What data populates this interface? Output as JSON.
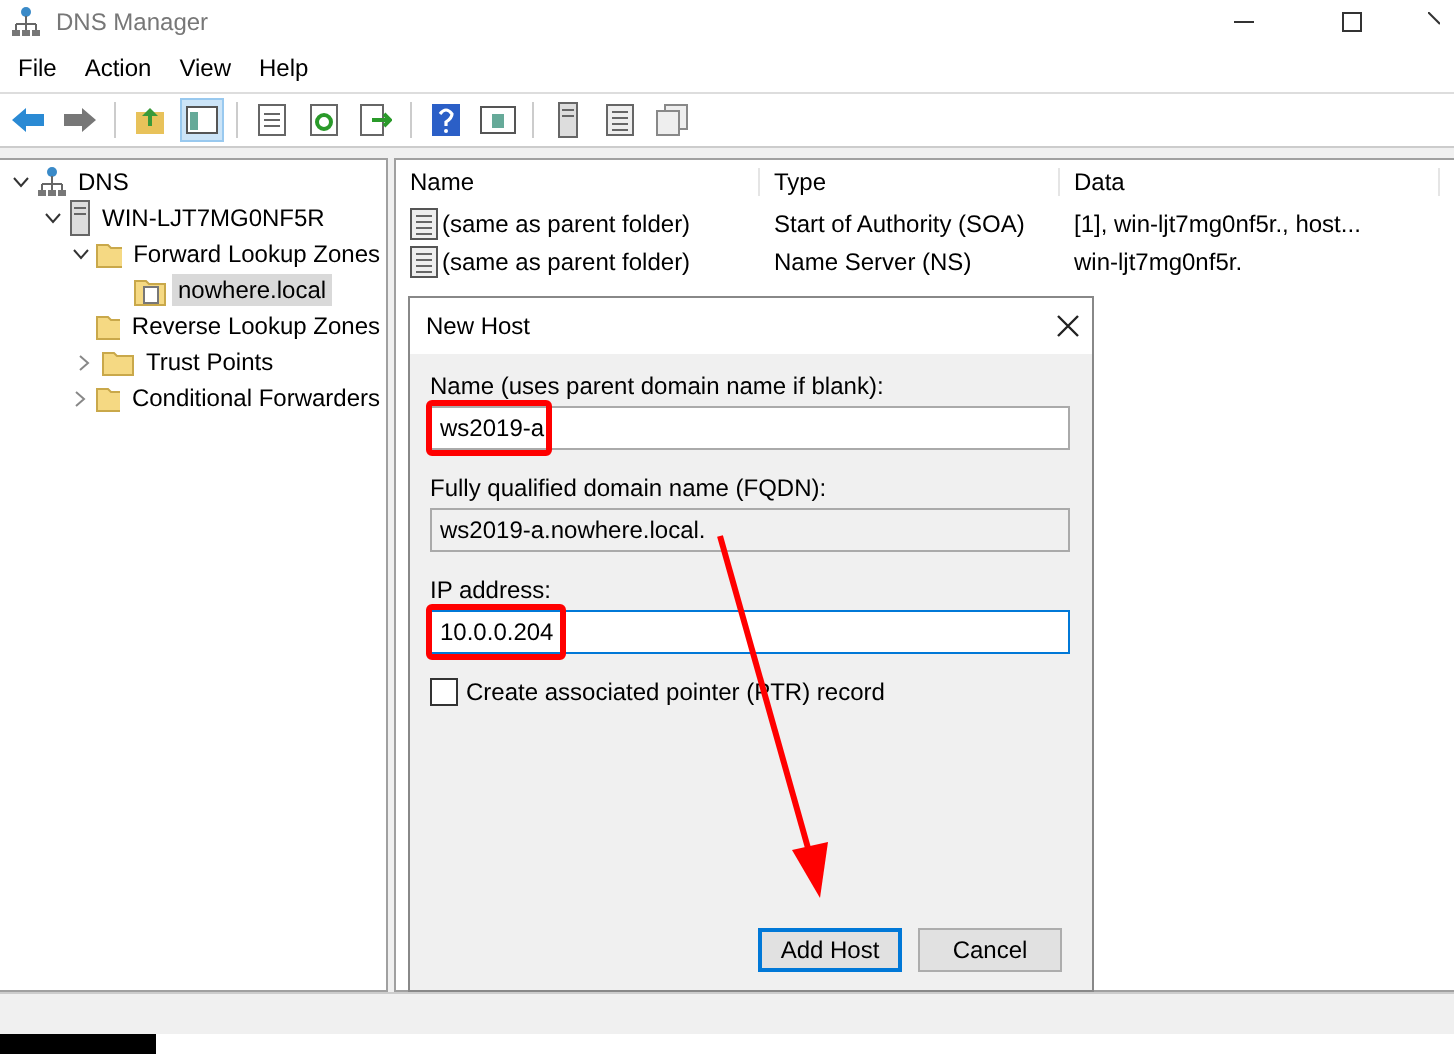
{
  "window": {
    "title": "DNS Manager"
  },
  "menu": [
    {
      "label": "File"
    },
    {
      "label": "Action"
    },
    {
      "label": "View"
    },
    {
      "label": "Help"
    }
  ],
  "toolbar": [
    {
      "kind": "back",
      "active": false
    },
    {
      "kind": "forward",
      "active": false
    },
    {
      "kind": "up",
      "active": false
    },
    {
      "kind": "tree",
      "active": true
    },
    {
      "kind": "properties",
      "active": false
    },
    {
      "kind": "refresh",
      "active": false
    },
    {
      "kind": "export",
      "active": false
    },
    {
      "kind": "help",
      "active": false
    },
    {
      "kind": "panel",
      "active": false
    },
    {
      "kind": "server",
      "active": false
    },
    {
      "kind": "list",
      "active": false
    },
    {
      "kind": "copy",
      "active": false
    }
  ],
  "tree": [
    {
      "label": "DNS",
      "kind": "root",
      "selected": false,
      "expanded": true,
      "children": [
        {
          "label": "WIN-LJT7MG0NF5R",
          "kind": "server",
          "selected": false,
          "expanded": true,
          "children": [
            {
              "label": "Forward Lookup Zones",
              "kind": "folder",
              "selected": false,
              "expanded": true,
              "children": [
                {
                  "label": "nowhere.local",
                  "kind": "zone",
                  "selected": true
                }
              ]
            },
            {
              "label": "Reverse Lookup Zones",
              "kind": "folder",
              "selected": false
            },
            {
              "label": "Trust Points",
              "kind": "folder",
              "selected": false,
              "expanded": false
            },
            {
              "label": "Conditional Forwarders",
              "kind": "folder",
              "selected": false,
              "expanded": false
            }
          ]
        }
      ]
    }
  ],
  "table": {
    "columns": [
      "Name",
      "Type",
      "Data"
    ],
    "rows": [
      {
        "name": "(same as parent folder)",
        "type": "Start of Authority (SOA)",
        "data": "[1], win-ljt7mg0nf5r., host..."
      },
      {
        "name": "(same as parent folder)",
        "type": "Name Server (NS)",
        "data": "win-ljt7mg0nf5r."
      }
    ]
  },
  "dialog": {
    "title": "New Host",
    "fields": [
      {
        "label": "Name (uses parent domain name if blank):",
        "value": "ws2019-a",
        "readonly": false,
        "focused": false,
        "highlighted": true
      },
      {
        "label": "Fully qualified domain name (FQDN):",
        "value": "ws2019-a.nowhere.local.",
        "readonly": true,
        "focused": false,
        "highlighted": false
      },
      {
        "label": "IP address:",
        "value": "10.0.0.204",
        "readonly": false,
        "focused": true,
        "highlighted": true
      }
    ],
    "checkbox": {
      "label": "Create associated pointer (PTR) record",
      "checked": false
    },
    "buttons": [
      {
        "label": "Add Host",
        "default": true
      },
      {
        "label": "Cancel",
        "default": false
      }
    ]
  }
}
